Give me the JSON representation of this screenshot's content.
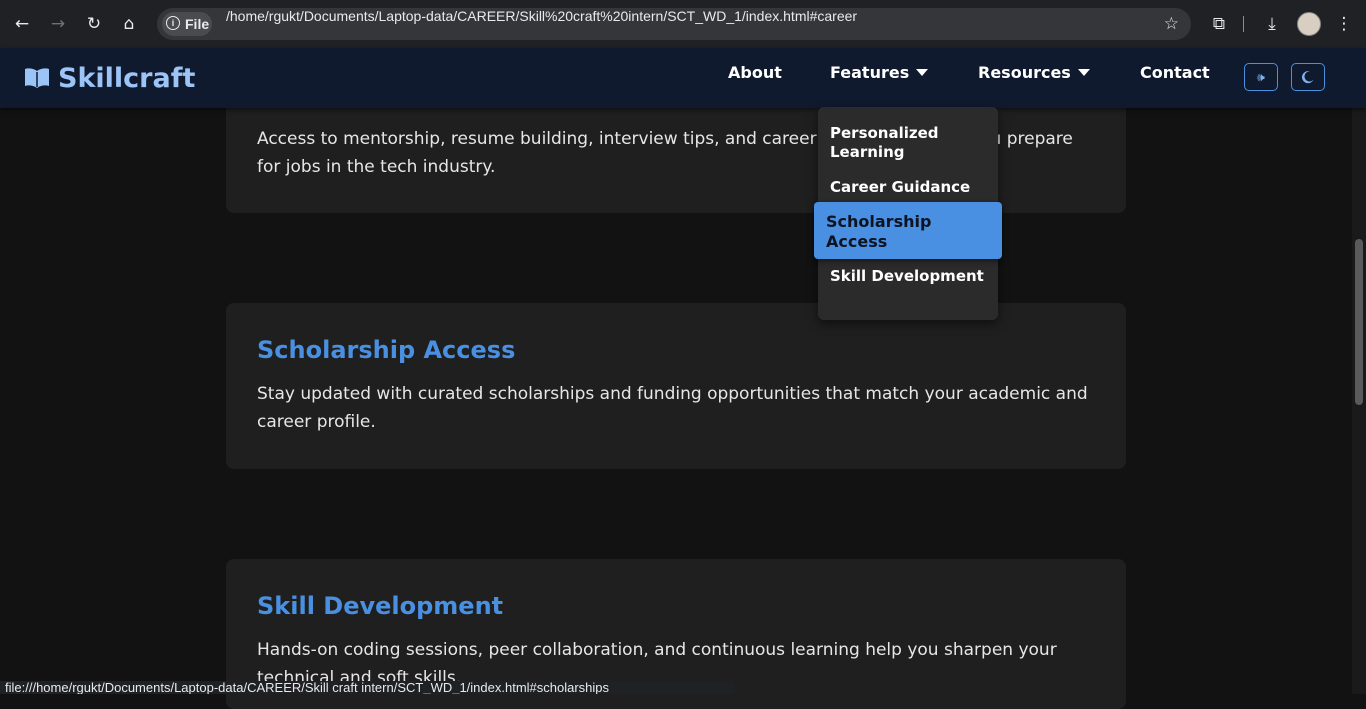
{
  "browser": {
    "chip_label": "File",
    "url": "/home/rgukt/Documents/Laptop-data/CAREER/Skill%20craft%20intern/SCT_WD_1/index.html#career",
    "status_url": "file:///home/rgukt/Documents/Laptop-data/CAREER/Skill craft intern/SCT_WD_1/index.html#scholarships"
  },
  "site": {
    "logo": "Skillcraft",
    "nav": {
      "about": "About",
      "features": "Features",
      "resources": "Resources",
      "contact": "Contact"
    },
    "icons": {
      "sound": "speaker-icon",
      "theme": "moon-icon"
    },
    "accent_color": "#4a90e2"
  },
  "dropdown": {
    "items": [
      "Personalized Learning",
      "Career Guidance",
      "Scholarship Access",
      "Skill Development"
    ],
    "active_index": 2
  },
  "cards": [
    {
      "title": "",
      "text": "Access to mentorship, resume building, interview tips, and career guidance to help you prepare for jobs in the tech industry."
    },
    {
      "title": "Scholarship Access",
      "text": "Stay updated with curated scholarships and funding opportunities that match your academic and career profile."
    },
    {
      "title": "Skill Development",
      "text": "Hands-on coding sessions, peer collaboration, and continuous learning help you sharpen your technical and soft skills."
    }
  ]
}
